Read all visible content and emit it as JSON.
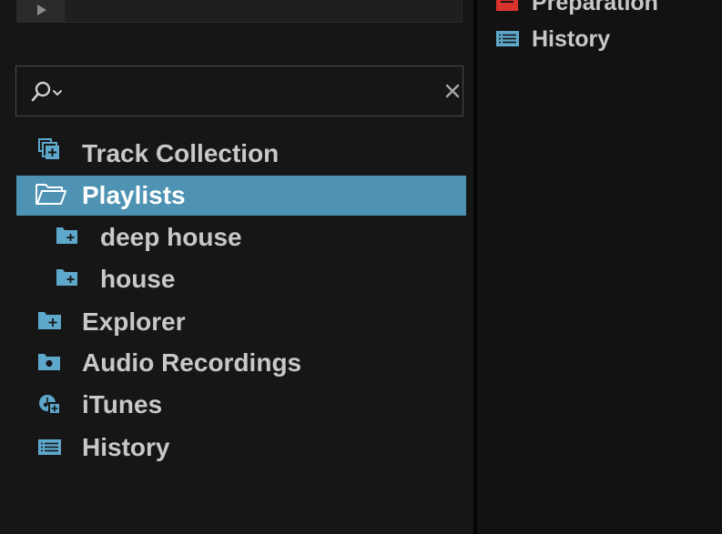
{
  "browser": {
    "search": {
      "value": "",
      "placeholder": ""
    },
    "tree": [
      {
        "label": "Track Collection",
        "icon": "track-collection-icon"
      },
      {
        "label": "Playlists",
        "icon": "folder-open-icon",
        "selected": true
      },
      {
        "label": "deep house",
        "icon": "playlist-icon"
      },
      {
        "label": "house",
        "icon": "playlist-icon"
      },
      {
        "label": "Explorer",
        "icon": "explorer-icon"
      },
      {
        "label": "Audio Recordings",
        "icon": "audio-recordings-icon"
      },
      {
        "label": "iTunes",
        "icon": "itunes-icon"
      },
      {
        "label": "History",
        "icon": "history-icon"
      }
    ]
  },
  "right_panel": {
    "items": [
      {
        "label": "Preparation",
        "icon": "preparation-icon"
      },
      {
        "label": "History",
        "icon": "history-icon"
      }
    ]
  },
  "colors": {
    "accent_selection": "#4e93b4",
    "icon_blue": "#5ea8cc",
    "preparation_red": "#d9332e",
    "text": "#c8c8c8",
    "panel_bg": "#161616"
  }
}
